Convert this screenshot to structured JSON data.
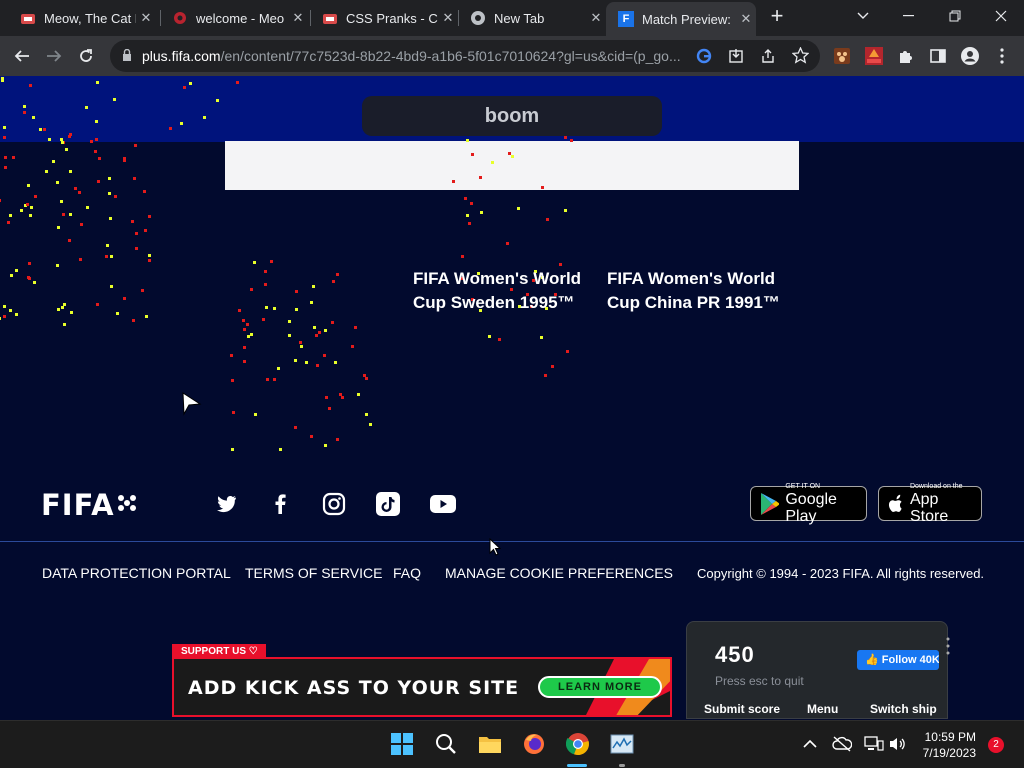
{
  "tabs": [
    {
      "title": "Meow, The Cat P",
      "close": "✕"
    },
    {
      "title": "welcome - Meo",
      "close": "✕"
    },
    {
      "title": "CSS Pranks - Ch",
      "close": "✕"
    },
    {
      "title": "New Tab",
      "close": "✕"
    },
    {
      "title": "Match Preview:",
      "close": "✕",
      "active": true
    }
  ],
  "new_tab_label": "+",
  "address": {
    "host": "plus.fifa.com",
    "path": "/en/content/77c7523d-8b22-4bd9-a1b6-5f01c7010624?gl=us&cid=(p_go..."
  },
  "page": {
    "boom_label": "boom",
    "cards": [
      {
        "title": "FIFA Women's World Cup Sweden 1995™"
      },
      {
        "title": "FIFA Women's World Cup China PR 1991™"
      }
    ],
    "logo": "FIFA",
    "store_badges": [
      {
        "small": "GET IT ON",
        "big": "Google Play"
      },
      {
        "small": "Download on the",
        "big": "App Store"
      }
    ],
    "footer_links": [
      "DATA PROTECTION PORTAL",
      "TERMS OF SERVICE",
      "FAQ",
      "MANAGE COOKIE PREFERENCES"
    ],
    "copyright": "Copyright © 1994 - 2023 FIFA. All rights reserved."
  },
  "ad": {
    "tag": "SUPPORT US ♡",
    "text": "ADD KICK ASS TO YOUR SITE",
    "button": "LEARN MORE"
  },
  "game": {
    "score": "450",
    "hint": "Press esc to quit",
    "follow": "Follow 40K",
    "buttons": [
      "Submit score",
      "Menu",
      "Switch ship"
    ]
  },
  "taskbar": {
    "time": "10:59 PM",
    "date": "7/19/2023",
    "notifications": "2"
  }
}
